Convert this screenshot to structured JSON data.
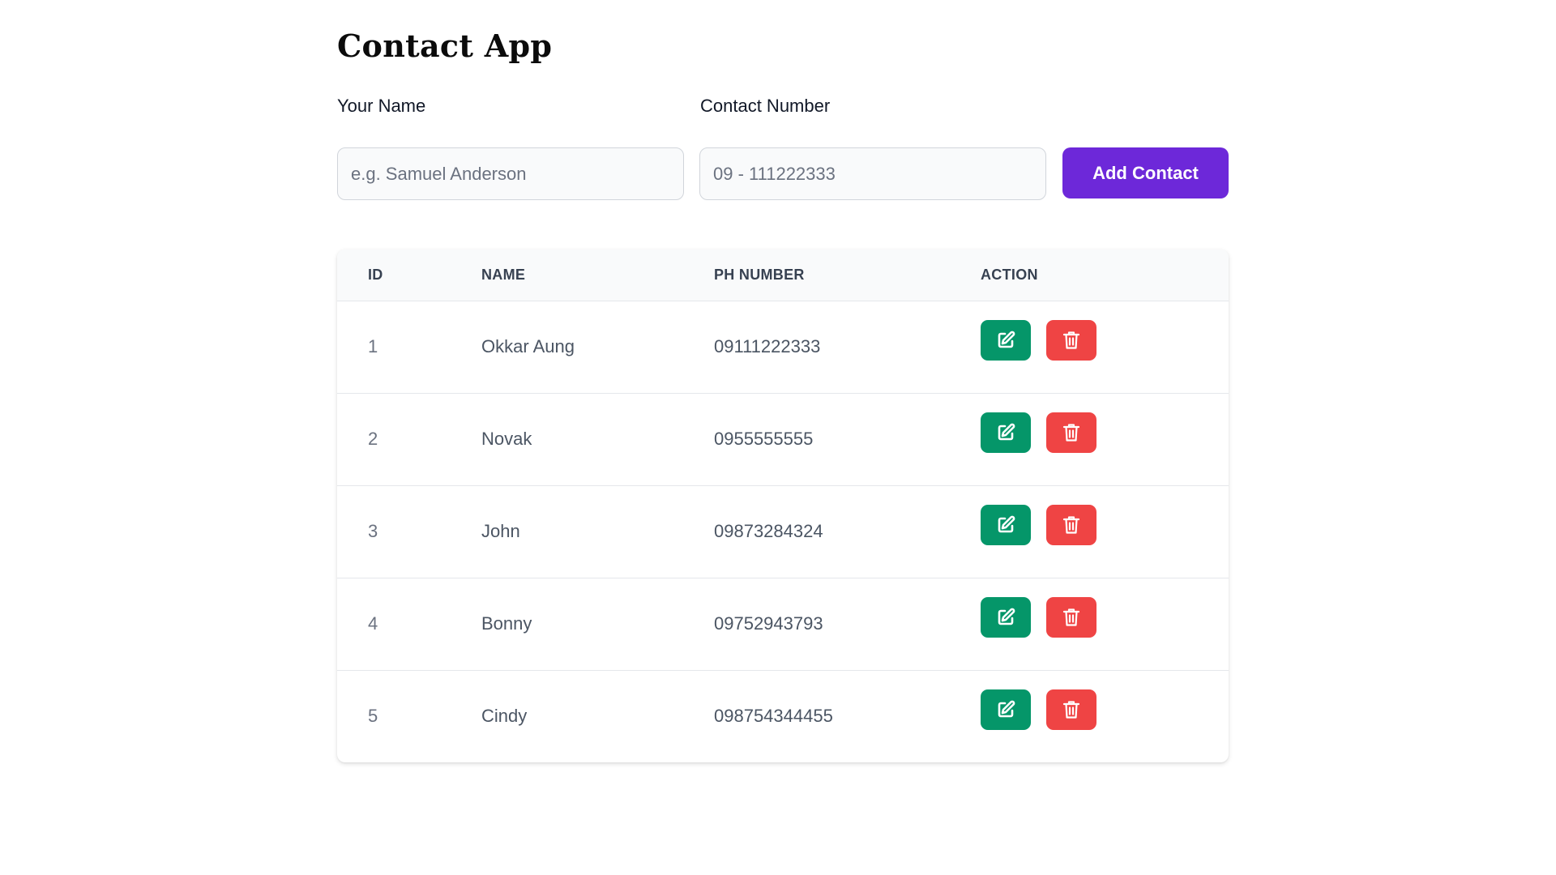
{
  "app": {
    "title": "Contact App"
  },
  "form": {
    "name_label": "Your Name",
    "name_placeholder": "e.g. Samuel Anderson",
    "name_value": "",
    "phone_label": "Contact Number",
    "phone_placeholder": "09 - 111222333",
    "phone_value": "",
    "add_button_label": "Add Contact"
  },
  "table": {
    "headers": {
      "id": "ID",
      "name": "NAME",
      "phone": "PH NUMBER",
      "action": "ACTION"
    },
    "rows": [
      {
        "id": "1",
        "name": "Okkar Aung",
        "phone": "09111222333"
      },
      {
        "id": "2",
        "name": "Novak",
        "phone": "0955555555"
      },
      {
        "id": "3",
        "name": "John",
        "phone": "09873284324"
      },
      {
        "id": "4",
        "name": "Bonny",
        "phone": "09752943793"
      },
      {
        "id": "5",
        "name": "Cindy",
        "phone": "098754344455"
      }
    ],
    "row_actions": {
      "edit_icon": "edit-icon",
      "delete_icon": "trash-icon"
    }
  },
  "colors": {
    "accent": "#6d28d9",
    "edit": "#059669",
    "delete": "#ef4444"
  }
}
